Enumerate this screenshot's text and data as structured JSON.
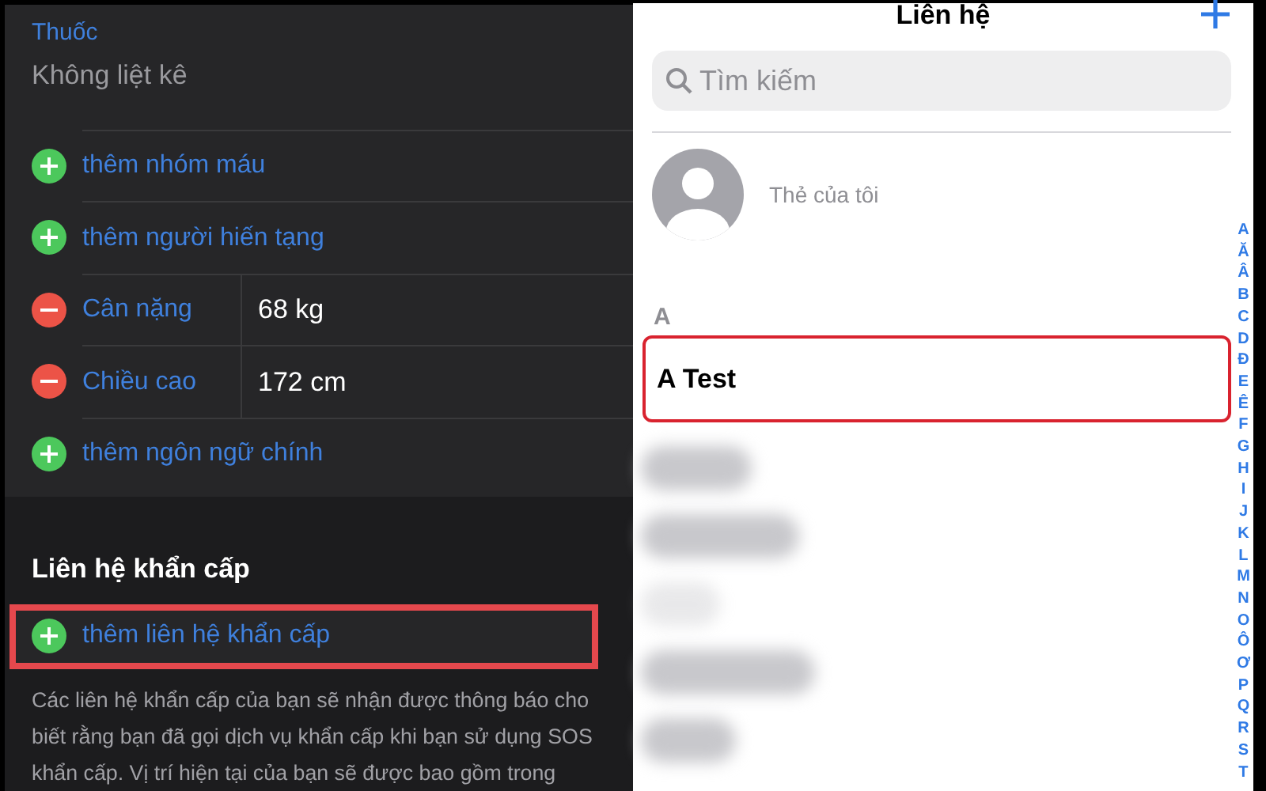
{
  "medical": {
    "medication": {
      "label": "Thuốc",
      "value": "Không liệt kê"
    },
    "rows": [
      {
        "kind": "add",
        "label": "thêm nhóm máu"
      },
      {
        "kind": "add",
        "label": "thêm người hiến tạng"
      },
      {
        "kind": "remove",
        "label": "Cân nặng",
        "value": "68 kg"
      },
      {
        "kind": "remove",
        "label": "Chiều cao",
        "value": "172 cm"
      },
      {
        "kind": "add",
        "label": "thêm ngôn ngữ chính"
      }
    ]
  },
  "emergency": {
    "header": "Liên hệ khẩn cấp",
    "add_row": {
      "label": "thêm liên hệ khẩn cấp",
      "highlighted": true
    },
    "footnote": "Các liên hệ khẩn cấp của bạn sẽ nhận được thông báo cho biết rằng bạn đã gọi dịch vụ khẩn cấp khi bạn sử dụng SOS khẩn cấp. Vị trí hiện tại của bạn sẽ được bao gồm trong"
  },
  "contacts": {
    "title": "Liên hệ",
    "search": {
      "placeholder": "Tìm kiếm"
    },
    "my_card": {
      "label": "Thẻ của tôi"
    },
    "sections": [
      {
        "letter": "A",
        "contacts": [
          {
            "name": "A Test",
            "highlighted": true
          }
        ]
      }
    ],
    "hidden_rows": [
      {
        "kind": "blurred"
      },
      {
        "kind": "blurred"
      },
      {
        "kind": "blurred"
      },
      {
        "kind": "blurred"
      },
      {
        "kind": "blurred"
      }
    ],
    "index": [
      "A",
      "Ă",
      "Â",
      "B",
      "C",
      "D",
      "Đ",
      "E",
      "Ê",
      "F",
      "G",
      "H",
      "I",
      "J",
      "K",
      "L",
      "M",
      "N",
      "O",
      "Ô",
      "Ơ",
      "P",
      "Q",
      "R",
      "S",
      "T"
    ]
  }
}
